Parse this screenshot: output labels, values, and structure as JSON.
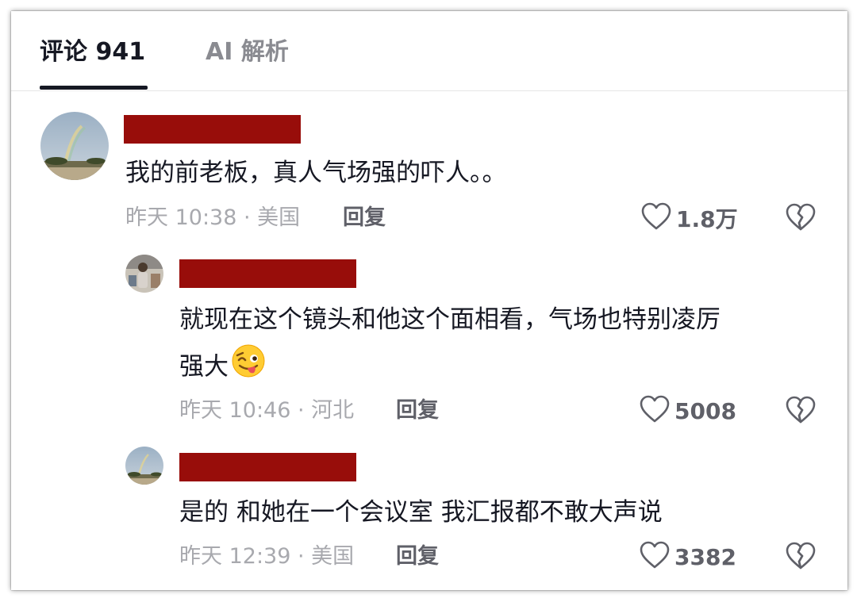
{
  "tabs": {
    "comments_label": "评论 941",
    "ai_label": "AI 解析"
  },
  "comments": [
    {
      "text": "我的前老板，真人气场强的吓人。。",
      "time_location": "昨天 10:38 · 美国",
      "reply_label": "回复",
      "likes": "1.8万"
    },
    {
      "text_line1": "就现在这个镜头和他这个面相看，气场也特别凌厉",
      "text_line2": "强大",
      "emoji": "winking-tongue-emoji",
      "time_location": "昨天 10:46 · 河北",
      "reply_label": "回复",
      "likes": "5008"
    },
    {
      "text": "是的 和她在一个会议室 我汇报都不敢大声说",
      "time_location": "昨天 12:39 · 美国",
      "reply_label": "回复",
      "likes": "3382"
    }
  ],
  "colors": {
    "redaction": "#980d0a",
    "text_primary": "#161823",
    "text_secondary": "#a8a9ae",
    "action": "#5f6068"
  },
  "icons": [
    "heart-outline-icon",
    "broken-heart-icon"
  ]
}
